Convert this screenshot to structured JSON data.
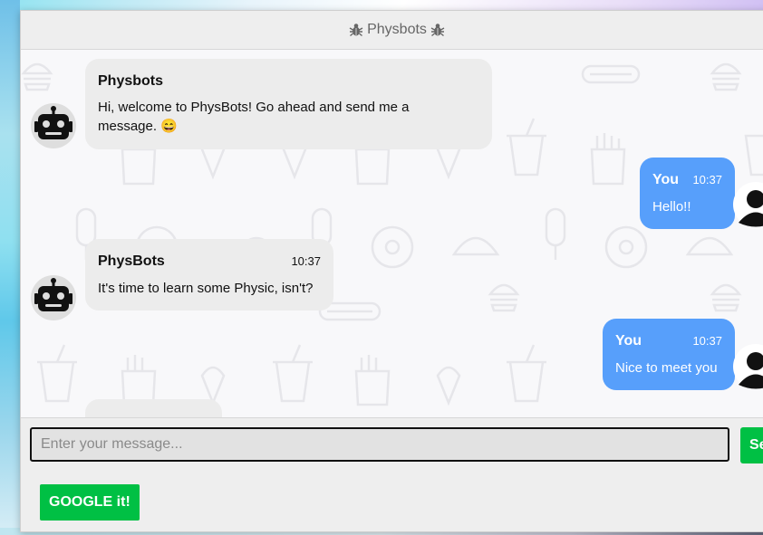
{
  "window": {
    "title": "Physbots"
  },
  "messages": [
    {
      "side": "bot",
      "name": "Physbots",
      "time": "",
      "text": "Hi, welcome to PhysBots! Go ahead and send me a message. 😄"
    },
    {
      "side": "user",
      "name": "You",
      "time": "10:37",
      "text": "Hello!!"
    },
    {
      "side": "bot",
      "name": "PhysBots",
      "time": "10:37",
      "text": "It's time to learn some Physic, isn't?"
    },
    {
      "side": "user",
      "name": "You",
      "time": "10:37",
      "text": "Nice to meet you"
    }
  ],
  "composer": {
    "placeholder": "Enter your message...",
    "send_label": "Se"
  },
  "footer": {
    "google_label": "GOOGLE it!"
  },
  "colors": {
    "user_bubble": "#579ffb",
    "bot_bubble": "#ececec",
    "button": "#00c044"
  }
}
